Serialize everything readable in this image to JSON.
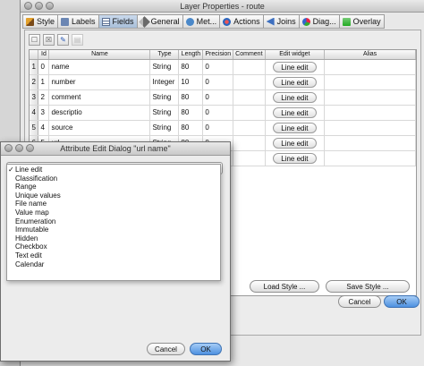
{
  "main_window": {
    "title": "Layer Properties - route",
    "tabs": [
      {
        "label": "Style",
        "icon": "style-icon"
      },
      {
        "label": "Labels",
        "icon": "labels-icon"
      },
      {
        "label": "Fields",
        "icon": "fields-icon",
        "active": true
      },
      {
        "label": "General",
        "icon": "general-icon"
      },
      {
        "label": "Met...",
        "icon": "metadata-icon"
      },
      {
        "label": "Actions",
        "icon": "actions-icon"
      },
      {
        "label": "Joins",
        "icon": "joins-icon"
      },
      {
        "label": "Diag...",
        "icon": "diagram-icon"
      },
      {
        "label": "Overlay",
        "icon": "overlay-icon"
      }
    ],
    "toolbar": [
      "new-column-icon",
      "delete-column-icon",
      "toggle-editing-icon",
      "field-calculator-icon"
    ],
    "table": {
      "columns": [
        "Id",
        "Name",
        "Type",
        "Length",
        "Precision",
        "Comment",
        "Edit widget",
        "Alias"
      ],
      "rows": [
        {
          "row": "1",
          "id": "0",
          "name": "name",
          "type": "String",
          "length": "80",
          "precision": "0",
          "comment": "",
          "widget": "Line edit",
          "alias": ""
        },
        {
          "row": "2",
          "id": "1",
          "name": "number",
          "type": "Integer",
          "length": "10",
          "precision": "0",
          "comment": "",
          "widget": "Line edit",
          "alias": ""
        },
        {
          "row": "3",
          "id": "2",
          "name": "comment",
          "type": "String",
          "length": "80",
          "precision": "0",
          "comment": "",
          "widget": "Line edit",
          "alias": ""
        },
        {
          "row": "4",
          "id": "3",
          "name": "descriptio",
          "type": "String",
          "length": "80",
          "precision": "0",
          "comment": "",
          "widget": "Line edit",
          "alias": ""
        },
        {
          "row": "5",
          "id": "4",
          "name": "source",
          "type": "String",
          "length": "80",
          "precision": "0",
          "comment": "",
          "widget": "Line edit",
          "alias": ""
        },
        {
          "row": "6",
          "id": "5",
          "name": "url",
          "type": "String",
          "length": "80",
          "precision": "0",
          "comment": "",
          "widget": "Line edit",
          "alias": ""
        },
        {
          "row": "7",
          "id": "6",
          "name": "",
          "type": "",
          "length": "",
          "precision": "",
          "comment": "",
          "widget": "Line edit",
          "alias": ""
        }
      ]
    },
    "buttons": {
      "load_style": "Load Style ...",
      "save_style": "Save Style ...",
      "cancel": "Cancel",
      "ok": "OK"
    }
  },
  "dialog": {
    "title": "Attribute Edit Dialog \"url name\"",
    "selected": "Line edit",
    "options": [
      "Line edit",
      "Classification",
      "Range",
      "Unique values",
      "File name",
      "Value map",
      "Enumeration",
      "Immutable",
      "Hidden",
      "Checkbox",
      "Text edit",
      "Calendar"
    ],
    "cancel": "Cancel",
    "ok": "OK"
  }
}
